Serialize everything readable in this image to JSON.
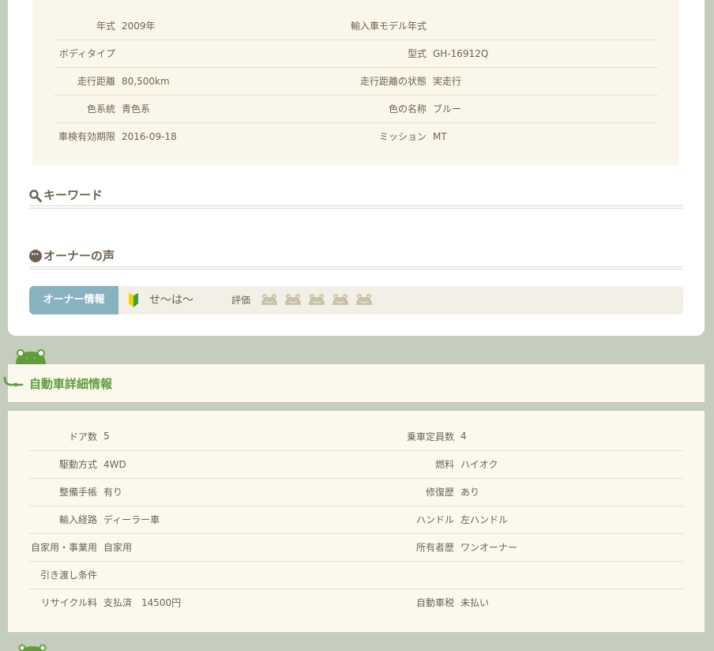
{
  "spec": {
    "rows": [
      {
        "l1": "年式",
        "v1": "2009年",
        "l2": "輸入車モデル年式",
        "v2": ""
      },
      {
        "l1": "ボディタイプ",
        "v1": "",
        "l2": "型式",
        "v2": "GH-16912Q"
      },
      {
        "l1": "走行距離",
        "v1": "80,500km",
        "l2": "走行距離の状態",
        "v2": "実走行"
      },
      {
        "l1": "色系統",
        "v1": "青色系",
        "l2": "色の名称",
        "v2": "ブルー"
      },
      {
        "l1": "車検有効期限",
        "v1": "2016-09-18",
        "l2": "ミッション",
        "v2": "MT"
      }
    ]
  },
  "keyword": {
    "title": "キーワード",
    "icon": "search-icon"
  },
  "owner_voice": {
    "title": "オーナーの声",
    "icon": "speech-bubble-icon"
  },
  "owner": {
    "tag": "オーナー情報",
    "name": "せ～は～",
    "rating_label": "評価",
    "rating": 0,
    "rating_max": 5
  },
  "detail": {
    "title": "自動車詳細情報",
    "rows": [
      {
        "l1": "ドア数",
        "v1": "5",
        "l2": "乗車定員数",
        "v2": "4"
      },
      {
        "l1": "駆動方式",
        "v1": "4WD",
        "l2": "燃料",
        "v2": "ハイオク"
      },
      {
        "l1": "整備手帳",
        "v1": "有り",
        "l2": "修復歴",
        "v2": "あり"
      },
      {
        "l1": "輸入経路",
        "v1": "ディーラー車",
        "l2": "ハンドル",
        "v2": "左ハンドル"
      },
      {
        "l1": "自家用・事業用",
        "v1": "自家用",
        "l2": "所有者歴",
        "v2": "ワンオーナー"
      },
      {
        "l1": "引き渡し条件",
        "v1": "",
        "l2": "",
        "v2": ""
      },
      {
        "l1": "リサイクル料",
        "v1": "支払済　14500円",
        "l2": "自動車税",
        "v2": "未払い"
      }
    ]
  },
  "colors": {
    "background": "#c5cdbc",
    "owner_tag": "#88b2c0",
    "accent_green": "#5e9d3a",
    "text": "#6b6350"
  }
}
